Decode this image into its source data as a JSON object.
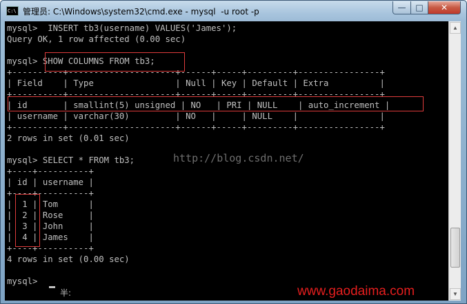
{
  "window": {
    "title": "管理员: C:\\Windows\\system32\\cmd.exe - mysql  -u root -p",
    "minimize_glyph": "—",
    "maximize_glyph": "□",
    "close_glyph": "✕",
    "icon": "cmd-icon",
    "icon_text": "C:\\"
  },
  "console": {
    "lines": [
      "mysql>  INSERT tb3(username) VALUES('James');",
      "Query OK, 1 row affected (0.00 sec)",
      "",
      "mysql> SHOW COLUMNS FROM tb3;",
      "+----------+---------------------+------+-----+---------+----------------+",
      "| Field    | Type                | Null | Key | Default | Extra          |",
      "+----------+---------------------+------+-----+---------+----------------+",
      "| id       | smallint(5) unsigned | NO   | PRI | NULL    | auto_increment |",
      "| username | varchar(30)         | NO   |     | NULL    |                |",
      "+----------+---------------------+------+-----+---------+----------------+",
      "2 rows in set (0.01 sec)",
      "",
      "mysql> SELECT * FROM tb3;",
      "+----+----------+",
      "| id | username |",
      "+----+----------+",
      "|  1 | Tom      |",
      "|  2 | Rose     |",
      "|  3 | John     |",
      "|  4 | James    |",
      "+----+----------+",
      "4 rows in set (0.00 sec)",
      "",
      "mysql> "
    ],
    "ime_indicator": "半:"
  },
  "watermarks": {
    "blog_url": "http://blog.csdn.net/",
    "brand": "www.gaodaima.com"
  },
  "colors": {
    "console_bg": "#000000",
    "console_text": "#c0c0c0",
    "highlight_box": "#e03c3c",
    "brand_text": "#e61e1e"
  }
}
